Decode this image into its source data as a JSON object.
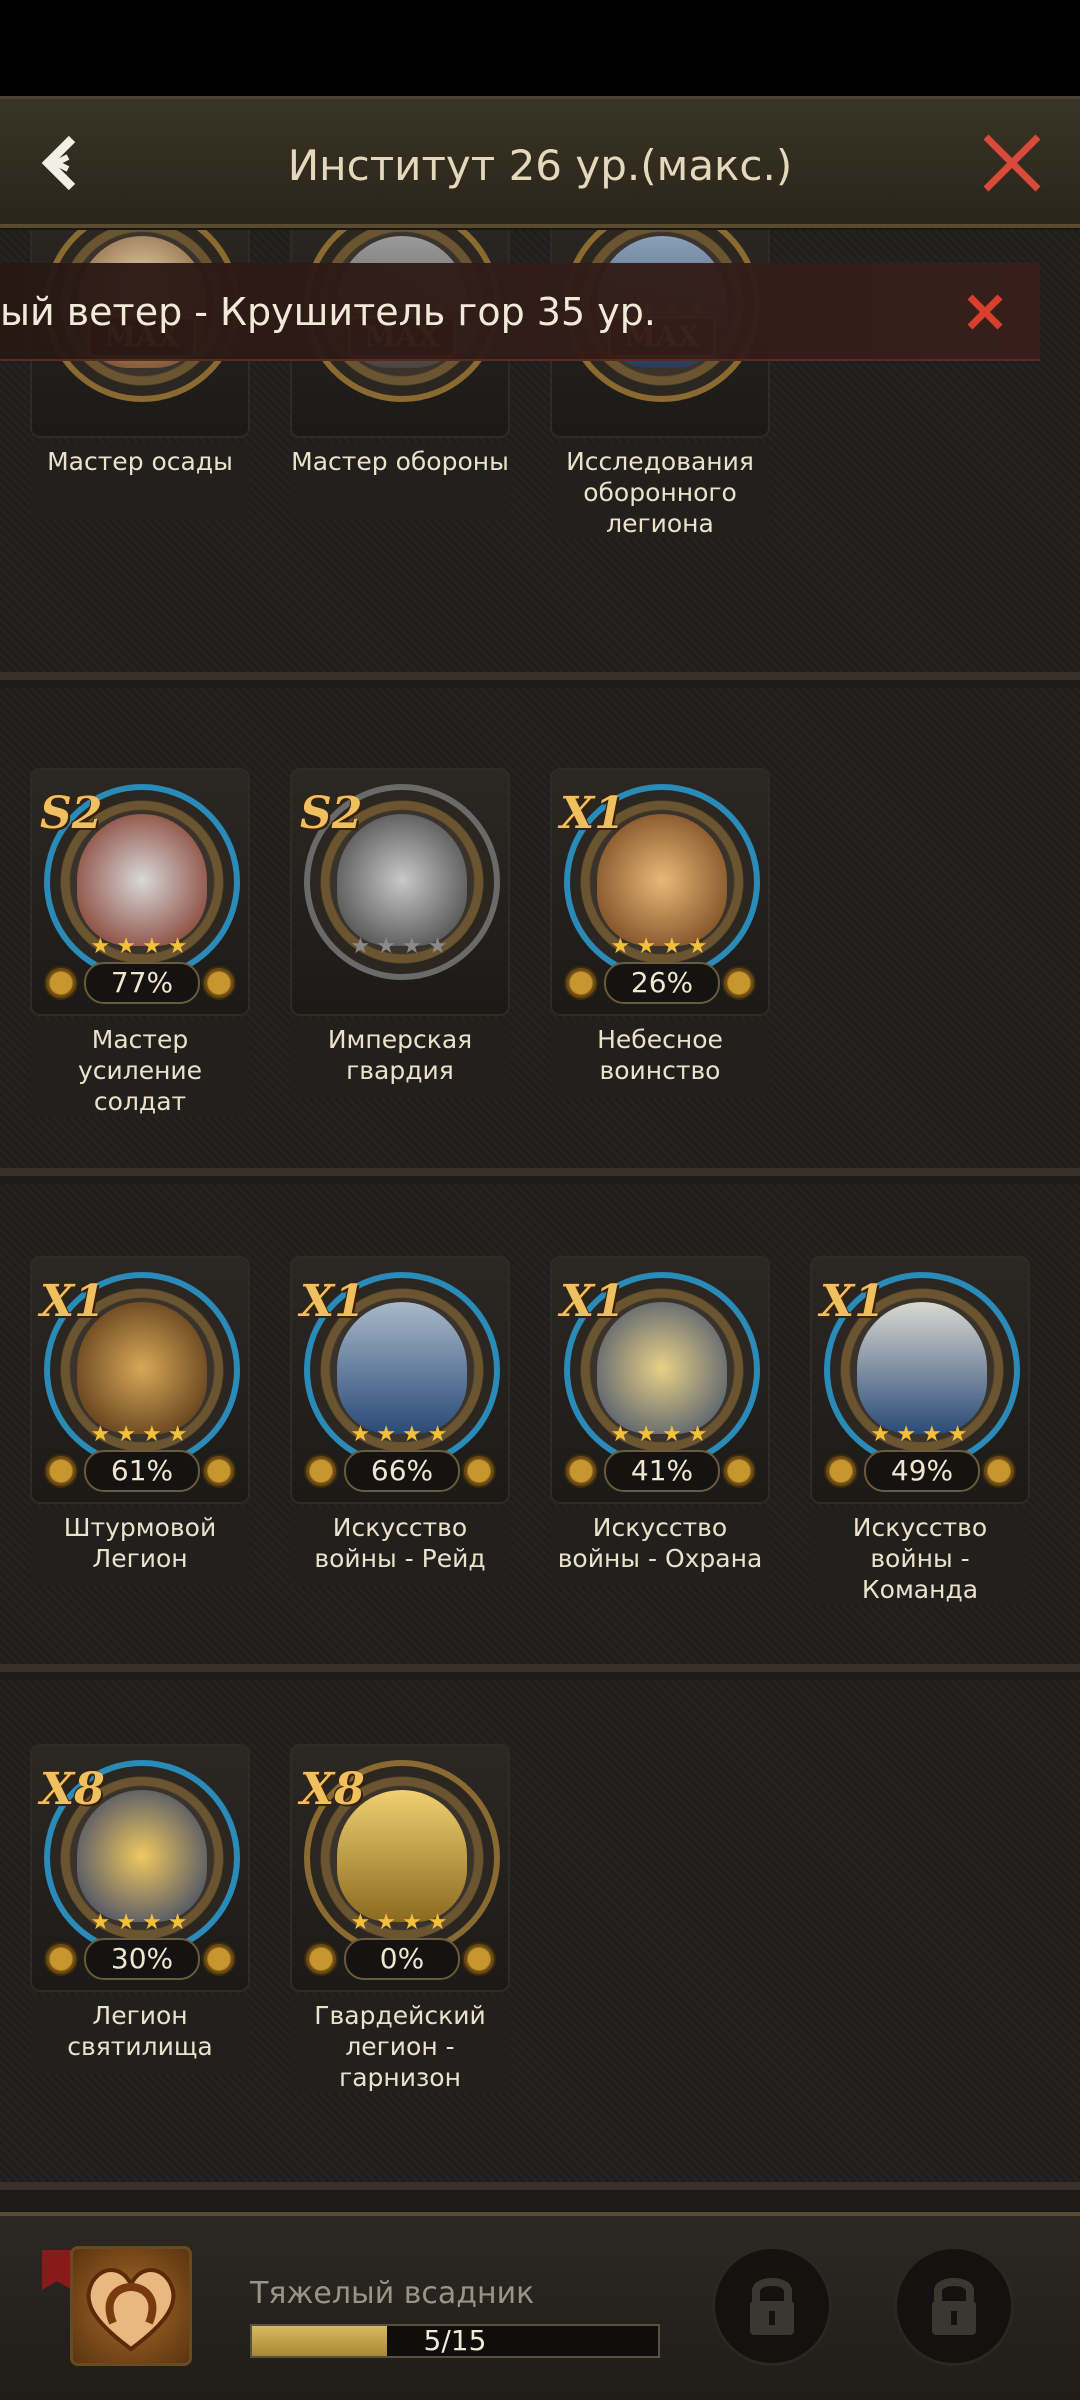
{
  "header": {
    "title": "Институт 26 ур.(макс.)",
    "back_icon": "back-arrow-icon",
    "close_icon": "close-x-icon"
  },
  "banner": {
    "text": "ый ветер - Крушитель гор 35 ур.",
    "close_icon": "close-x-icon"
  },
  "sections": [
    {
      "nodes": [
        {
          "name": "Мастер осады",
          "state": "MAX",
          "stars_filled": 4,
          "stars_total": 4,
          "icon": "knight-chess-icon"
        },
        {
          "name": "Мастер обороны",
          "state": "MAX",
          "stars_filled": 4,
          "stars_total": 4,
          "icon": "fortress-gate-icon"
        },
        {
          "name": "Исследования оборонного легиона",
          "state": "MAX",
          "stars_filled": 4,
          "stars_total": 4,
          "icon": "shields-icon"
        }
      ]
    },
    {
      "nodes": [
        {
          "name": "Мастер усиление солдат",
          "badge": "S2",
          "progress": "77%",
          "progress_value": 0.77,
          "stars_filled": 4,
          "stars_total": 4,
          "icon": "gauntlet-icon"
        },
        {
          "name": "Имперская гвардия",
          "badge": "S2",
          "progress": "",
          "progress_value": 0,
          "stars_filled": 0,
          "stars_total": 4,
          "icon": "knight-helmet-icon"
        },
        {
          "name": "Небесное воинство",
          "badge": "X1",
          "progress": "26%",
          "progress_value": 0.26,
          "stars_filled": 4,
          "stars_total": 4,
          "icon": "crusader-helmet-icon"
        }
      ]
    },
    {
      "nodes": [
        {
          "name": "Штурмовой Легион",
          "badge": "X1",
          "progress": "61%",
          "progress_value": 0.61,
          "stars_filled": 4,
          "stars_total": 4,
          "icon": "lion-emblem-icon"
        },
        {
          "name": "Искусство войны - Рейд",
          "badge": "X1",
          "progress": "66%",
          "progress_value": 0.66,
          "stars_filled": 4,
          "stars_total": 4,
          "icon": "crossed-swords-castle-icon"
        },
        {
          "name": "Искусство войны - Охрана",
          "badge": "X1",
          "progress": "41%",
          "progress_value": 0.41,
          "stars_filled": 4,
          "stars_total": 4,
          "icon": "crossed-axes-icon"
        },
        {
          "name": "Искусство войны - Команда",
          "badge": "X1",
          "progress": "49%",
          "progress_value": 0.49,
          "stars_filled": 4,
          "stars_total": 4,
          "icon": "war-horns-icon"
        }
      ]
    },
    {
      "nodes": [
        {
          "name": "Легион святилища",
          "badge": "X8",
          "progress": "30%",
          "progress_value": 0.3,
          "stars_filled": 4,
          "stars_total": 4,
          "icon": "plumed-helmet-icon"
        },
        {
          "name": "Гвардейский легион - гарнизон",
          "badge": "X8",
          "progress": "0%",
          "progress_value": 0,
          "stars_filled": 4,
          "stars_total": 4,
          "icon": "golden-tower-icon"
        }
      ]
    }
  ],
  "bottom": {
    "unit_name": "Тяжелый всадник",
    "progress_text": "5/15",
    "progress_value": 0.3333,
    "unit_icon": "heart-horseshoe-icon",
    "lock_icons": [
      "padlock-icon",
      "padlock-icon"
    ]
  }
}
